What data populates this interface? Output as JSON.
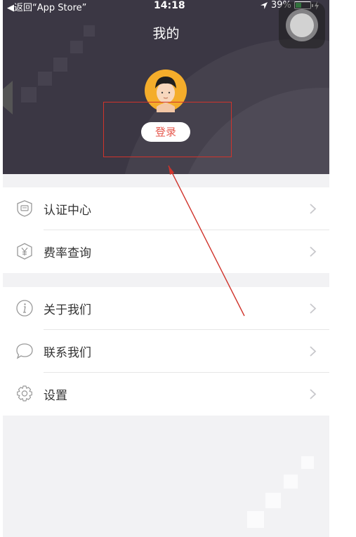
{
  "status_bar": {
    "back": "◀返回“App Store”",
    "time": "14:18",
    "battery": "39%"
  },
  "header": {
    "title": "我的",
    "login_label": "登录"
  },
  "menu_group1": [
    {
      "label": "认证中心",
      "icon": "id-card-shield-icon"
    },
    {
      "label": "费率查询",
      "icon": "yen-shield-icon"
    }
  ],
  "menu_group2": [
    {
      "label": "关于我们",
      "icon": "info-circle-icon"
    },
    {
      "label": "联系我们",
      "icon": "chat-bubble-icon"
    },
    {
      "label": "设置",
      "icon": "gear-icon"
    }
  ],
  "colors": {
    "header_bg": "#3b3744",
    "login_text": "#e6574c",
    "annotation": "#d0342c"
  }
}
